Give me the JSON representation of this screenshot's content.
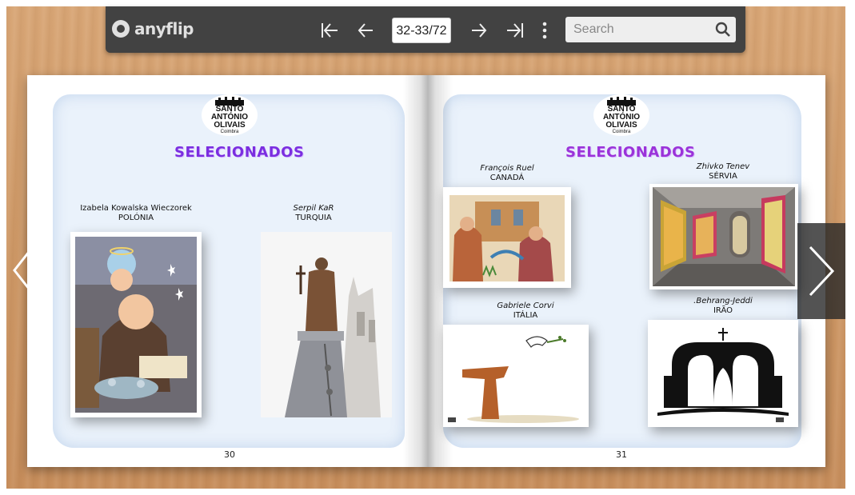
{
  "toolbar": {
    "logo_text": "anyflip",
    "page_indicator": "32-33/72",
    "search_placeholder": "Search",
    "icons": [
      "first-page-icon",
      "prev-page-icon",
      "next-page-icon",
      "last-page-icon",
      "more-options-icon",
      "search-icon"
    ]
  },
  "emblem": {
    "line1": "SANTO",
    "line2": "ANTÓNIO",
    "line3": "OLIVAIS",
    "line4": "Coimbra"
  },
  "left_page": {
    "title": "SELECIONADOS",
    "page_number": "30",
    "entries": [
      {
        "name": "Izabela Kowalska Wieczorek",
        "country": "POLÓNIA"
      },
      {
        "name": "Serpil KaR",
        "country": "TURQUIA"
      }
    ]
  },
  "right_page": {
    "title": "SELECIONADOS",
    "page_number": "31",
    "entries": [
      {
        "name": "François Ruel",
        "country": "CANADÁ"
      },
      {
        "name": "Zhivko Tenev",
        "country": "SÉRVIA"
      },
      {
        "name": "Gabriele Corvi",
        "country": "ITÁLIA"
      },
      {
        "name": ".Behrang-Jeddi",
        "country": "IRÃO"
      }
    ]
  },
  "colors": {
    "toolbar": "#424242",
    "title_purple": "#7b2ee0",
    "wood": "#cf9a68"
  }
}
